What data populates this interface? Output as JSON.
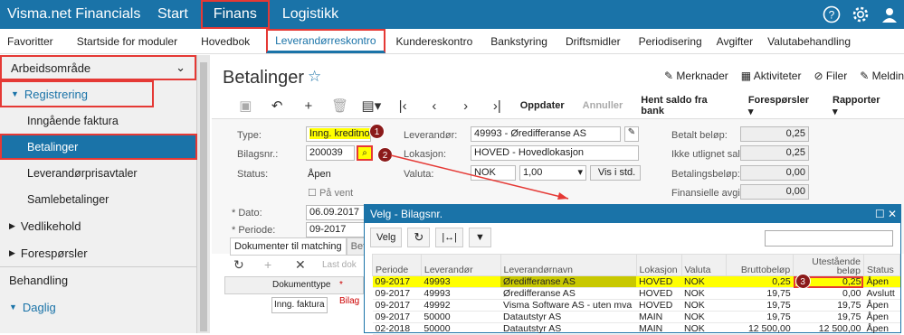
{
  "brand": "Visma.net Financials",
  "topnav": [
    "Start",
    "Finans",
    "Logistikk"
  ],
  "topicons": [
    "help-icon",
    "gear-icon",
    "user-icon"
  ],
  "modules": [
    "Favoritter",
    "Startside for moduler",
    "Hovedbok",
    "Leverandørreskontro",
    "Kundereskontro",
    "Bankstyring",
    "Driftsmidler",
    "Periodisering",
    "Avgifter",
    "Valutabehandling"
  ],
  "sidebar": {
    "header": "Arbeidsområde",
    "registrering": "Registrering",
    "items": [
      "Inngående faktura",
      "Betalinger",
      "Leverandørprisavtaler",
      "Samlebetalinger"
    ],
    "vedlikehold": "Vedlikehold",
    "foresporsler": "Forespørsler",
    "behandling": "Behandling",
    "daglig": "Daglig"
  },
  "page": {
    "title": "Betalinger",
    "buttons": [
      "Merknader",
      "Aktiviteter",
      "Filer",
      "Meldin"
    ],
    "toolbar": [
      "Oppdater",
      "Annuller",
      "Hent saldo fra bank",
      "Forespørsler",
      "Rapporter"
    ]
  },
  "form": {
    "type_label": "Type:",
    "type_value": "Inng. kreditnota",
    "bilag_label": "Bilagsnr.:",
    "bilag_value": "200039",
    "status_label": "Status:",
    "status_value": "Åpen",
    "paavent": "På vent",
    "dato_label": "Dato:",
    "dato_value": "06.09.2017",
    "periode_label": "Periode:",
    "periode_value": "09-2017",
    "lev_label": "Leverandør:",
    "lev_value": "49993 - Øredifferanse AS",
    "lok_label": "Lokasjon:",
    "lok_value": "HOVED - Hovedlokasjon",
    "valuta_label": "Valuta:",
    "valuta_value": "NOK",
    "kurs_value": "1,00",
    "vis_btn": "Vis i std.",
    "betalt_label": "Betalt beløp:",
    "betalt_value": "0,25",
    "ikke_label": "Ikke utlignet saldo:",
    "ikke_value": "0,25",
    "betbel_label": "Betalingsbeløp:",
    "betbel_value": "0,00",
    "fin_label": "Finansielle avgif...",
    "fin_value": "0,00",
    "badges": [
      "1",
      "2",
      "3"
    ]
  },
  "tabs": [
    "Dokumenter til matching",
    "Betalin"
  ],
  "subgrid": {
    "last": "Last dok",
    "col_doctype": "Dokumenttype",
    "col_bilag": "Bilag",
    "row_value": "Inng. faktura"
  },
  "popup": {
    "title": "Velg - Bilagsnr.",
    "velg": "Velg",
    "columns": [
      "Periode",
      "Leverandør",
      "Leverandørnavn",
      "Lokasjon",
      "Valuta",
      "Bruttobeløp",
      "Utestående beløp",
      "Status"
    ],
    "rows": [
      [
        "09-2017",
        "49993",
        "Øredifferanse AS",
        "HOVED",
        "NOK",
        "0,25",
        "0,25",
        "Åpen"
      ],
      [
        "09-2017",
        "49993",
        "Øredifferanse AS",
        "HOVED",
        "NOK",
        "19,75",
        "0,00",
        "Avslutt"
      ],
      [
        "09-2017",
        "49992",
        "Visma Software AS - uten mva",
        "HOVED",
        "NOK",
        "19,75",
        "19,75",
        "Åpen"
      ],
      [
        "09-2017",
        "50000",
        "Datautstyr AS",
        "MAIN",
        "NOK",
        "19,75",
        "19,75",
        "Åpen"
      ],
      [
        "02-2018",
        "50000",
        "Datautstyr AS",
        "MAIN",
        "NOK",
        "12 500,00",
        "12 500,00",
        "Åpen"
      ]
    ]
  }
}
